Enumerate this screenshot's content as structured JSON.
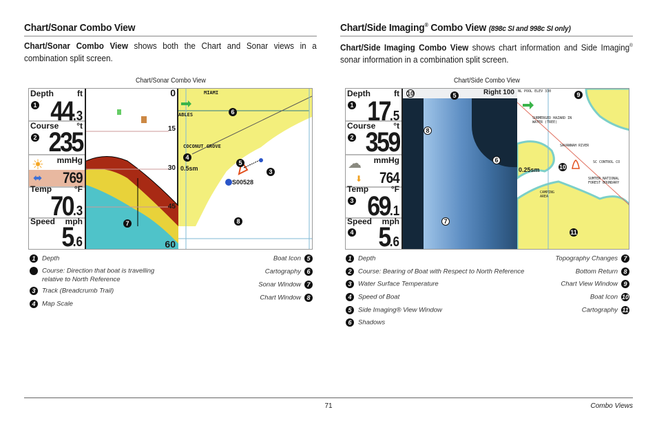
{
  "left": {
    "heading": "Chart/Sonar Combo View",
    "intro_bold": "Chart/Sonar Combo View",
    "intro_rest": " shows both the Chart and Sonar views in a combination split screen.",
    "caption": "Chart/Sonar Combo View",
    "screen": {
      "depth_label": "Depth",
      "depth_unit": "ft",
      "depth_int": "44",
      "depth_dec": ".3",
      "course_label": "Course",
      "course_unit": "°t",
      "course": "235",
      "pressure_unit": "mmHg",
      "pressure": "769",
      "temp_label": "Temp",
      "temp_unit": "°F",
      "temp_int": "70",
      "temp_dec": ".3",
      "speed_label": "Speed",
      "speed_unit": "mph",
      "speed_int": "5",
      "speed_dec": ".6",
      "sonar_depths": [
        "0",
        "15",
        "30",
        "45",
        "60"
      ],
      "map_labels": {
        "city": "MIAMI",
        "ables": "ABLES",
        "grove": "COCONUT GROVE",
        "scale": "0.5sm",
        "waypoint": "S00528"
      }
    },
    "legend": [
      {
        "n": "1",
        "text": "Depth"
      },
      {
        "n": "2",
        "text": "Course: Direction that boat is travelling relative to North Reference"
      },
      {
        "n": "3",
        "text": "Track (Breadcrumb Trail)"
      },
      {
        "n": "4",
        "text": "Map Scale"
      },
      {
        "n": "5",
        "text": "Boat Icon"
      },
      {
        "n": "6",
        "text": "Cartography"
      },
      {
        "n": "7",
        "text": "Sonar Window"
      },
      {
        "n": "8",
        "text": "Chart Window"
      }
    ]
  },
  "right": {
    "heading": "Chart/Side Imaging",
    "heading_reg": "®",
    "heading_tail": " Combo View ",
    "heading_note": "(898c SI and 998c SI only)",
    "intro_bold": "Chart/Side Imaging Combo View",
    "intro_rest1": " shows chart information and Side Imaging",
    "intro_reg": "®",
    "intro_rest2": " sonar information in a combination split screen.",
    "caption": "Chart/Side Combo View",
    "screen": {
      "depth_label": "Depth",
      "depth_unit": "ft",
      "depth_int": "17",
      "depth_dec": ".5",
      "course_label": "Course",
      "course_unit": "°t",
      "course": "359",
      "pressure_unit": "mmHg",
      "pressure": "764",
      "temp_label": "Temp",
      "temp_unit": "°F",
      "temp_int": "69",
      "temp_dec": ".1",
      "speed_label": "Speed",
      "speed_unit": "mph",
      "speed_int": "5",
      "speed_dec": ".6",
      "si_range": "Right 100",
      "map_labels": {
        "pool": "NL POOL ELEV 330",
        "hazard": "SUBMERGED HAZARD IN WATER (TREE)",
        "river": "SAVANNAH RIVER",
        "scale": "0.25sm",
        "camping": "CAMPING AREA",
        "forest": "SUMTER NATIONAL FOREST BOUNDARY",
        "sc": "SC CONTROL CO"
      }
    },
    "legend": [
      {
        "n": "1",
        "text": "Depth"
      },
      {
        "n": "2",
        "text": "Course: Bearing of Boat with Respect to North Reference"
      },
      {
        "n": "3",
        "text": "Water Surface Temperature"
      },
      {
        "n": "4",
        "text": "Speed of Boat"
      },
      {
        "n": "5",
        "text": "Side Imaging® View Window"
      },
      {
        "n": "6",
        "text": "Shadows"
      },
      {
        "n": "7",
        "text": "Topography Changes"
      },
      {
        "n": "8",
        "text": "Bottom Return"
      },
      {
        "n": "9",
        "text": "Chart View Window"
      },
      {
        "n": "10",
        "text": "Boat Icon"
      },
      {
        "n": "11",
        "text": "Cartography"
      }
    ]
  },
  "footer": {
    "page": "71",
    "section": "Combo Views"
  }
}
